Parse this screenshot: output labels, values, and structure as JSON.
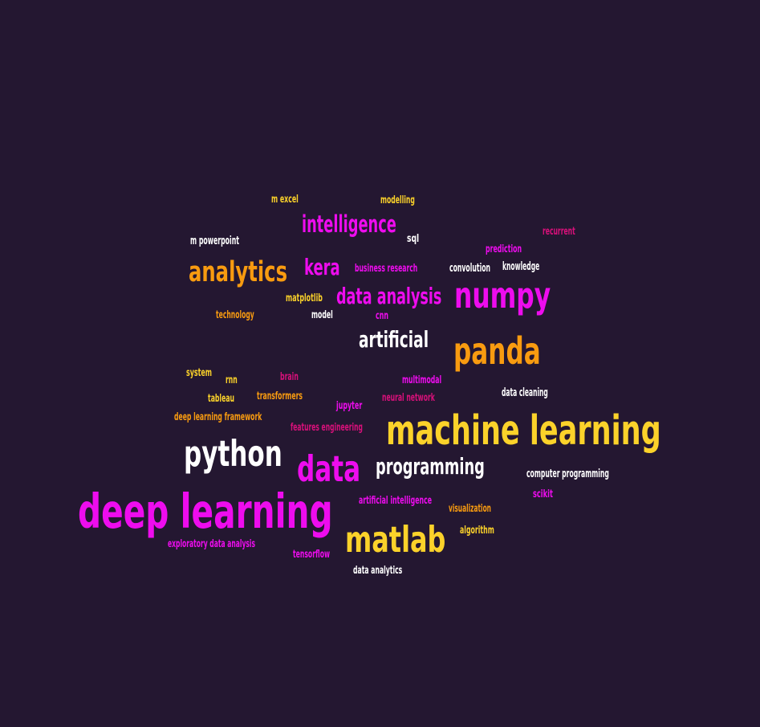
{
  "colors": {
    "background": "#241731",
    "magenta": "#ee0cee",
    "orange": "#f89b10",
    "yellow": "#fbd22a",
    "white": "#ffffff",
    "pink": "#d8107a"
  },
  "words": [
    {
      "text": "m excel",
      "color": "#fbd22a"
    },
    {
      "text": "modelling",
      "color": "#fbd22a"
    },
    {
      "text": "intelligence",
      "color": "#ee0cee"
    },
    {
      "text": "recurrent",
      "color": "#d8107a"
    },
    {
      "text": "m powerpoint",
      "color": "#ffffff"
    },
    {
      "text": "sql",
      "color": "#ffffff"
    },
    {
      "text": "prediction",
      "color": "#ee0cee"
    },
    {
      "text": "analytics",
      "color": "#f89b10"
    },
    {
      "text": "kera",
      "color": "#ee0cee"
    },
    {
      "text": "business research",
      "color": "#ee0cee"
    },
    {
      "text": "convolution",
      "color": "#ffffff"
    },
    {
      "text": "knowledge",
      "color": "#ffffff"
    },
    {
      "text": "data analysis",
      "color": "#ee0cee"
    },
    {
      "text": "numpy",
      "color": "#ee0cee"
    },
    {
      "text": "matplotlib",
      "color": "#fbd22a"
    },
    {
      "text": "technology",
      "color": "#f89b10"
    },
    {
      "text": "model",
      "color": "#ffffff"
    },
    {
      "text": "cnn",
      "color": "#ee0cee"
    },
    {
      "text": "artificial",
      "color": "#ffffff"
    },
    {
      "text": "panda",
      "color": "#f89b10"
    },
    {
      "text": "system",
      "color": "#fbd22a"
    },
    {
      "text": "rnn",
      "color": "#fbd22a"
    },
    {
      "text": "brain",
      "color": "#d8107a"
    },
    {
      "text": "multimodal",
      "color": "#ee0cee"
    },
    {
      "text": "tableau",
      "color": "#fbd22a"
    },
    {
      "text": "transformers",
      "color": "#f89b10"
    },
    {
      "text": "neural network",
      "color": "#d8107a"
    },
    {
      "text": "data cleaning",
      "color": "#ffffff"
    },
    {
      "text": "jupyter",
      "color": "#ee0cee"
    },
    {
      "text": "deep learning framework",
      "color": "#f89b10"
    },
    {
      "text": "features engineering",
      "color": "#d8107a"
    },
    {
      "text": "machine learning",
      "color": "#fbd22a"
    },
    {
      "text": "python",
      "color": "#ffffff"
    },
    {
      "text": "data",
      "color": "#ee0cee"
    },
    {
      "text": "programming",
      "color": "#ffffff"
    },
    {
      "text": "computer programming",
      "color": "#ffffff"
    },
    {
      "text": "scikit",
      "color": "#ee0cee"
    },
    {
      "text": "artificial intelligence",
      "color": "#ee0cee"
    },
    {
      "text": "visualization",
      "color": "#f89b10"
    },
    {
      "text": "deep learning",
      "color": "#ee0cee"
    },
    {
      "text": "algorithm",
      "color": "#fbd22a"
    },
    {
      "text": "matlab",
      "color": "#fbd22a"
    },
    {
      "text": "exploratory data analysis",
      "color": "#ee0cee"
    },
    {
      "text": "tensorflow",
      "color": "#ee0cee"
    },
    {
      "text": "data analytics",
      "color": "#ffffff"
    }
  ]
}
